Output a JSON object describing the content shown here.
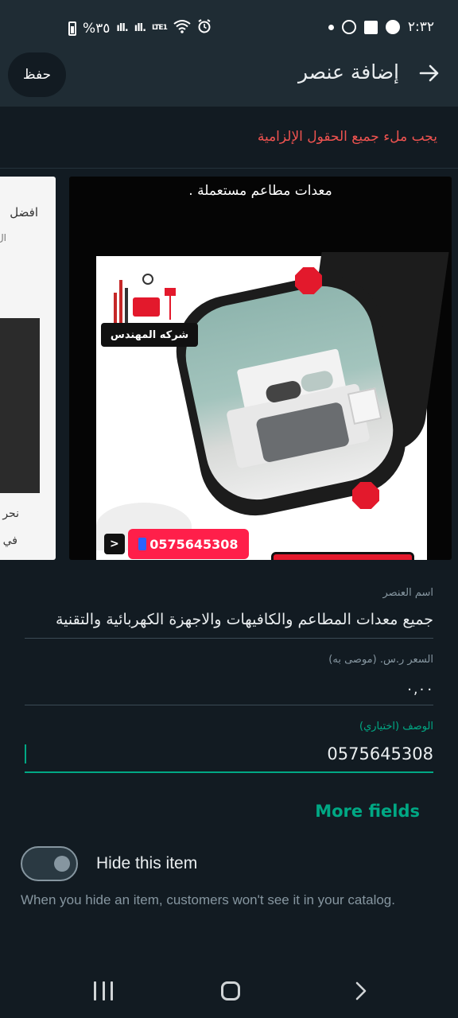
{
  "status_bar": {
    "time": "٢:٣٢",
    "battery": "%٣٥",
    "network_label": "LTE1",
    "icons": [
      "whatsapp-icon",
      "facebook-icon",
      "shazam-icon",
      "alarm-icon",
      "wifi-icon",
      "signal-icon",
      "battery-icon"
    ]
  },
  "appbar": {
    "title": "إضافة عنصر",
    "save_label": "حفظ"
  },
  "error": {
    "message": "يجب ملء جميع الحقول الإلزامية",
    "color": "#ef5350"
  },
  "images": {
    "previous_thumb": {
      "line1": "افضل",
      "line2": "ال",
      "line3": "نحر",
      "line4": "في"
    },
    "main_thumb": {
      "headline": "معدات مطاعم مستعملة .",
      "company_tag": "شركه المهندس",
      "phone": "0575645308"
    }
  },
  "form": {
    "name": {
      "label": "اسم العنصر",
      "value": "جميع معدات المطاعم والكافيهات والاجهزة الكهربائية والتقنية"
    },
    "price": {
      "label": "السعر ر.س. (موصى به)",
      "value": "٠,٠٠"
    },
    "description": {
      "label": "الوصف (اختياري)",
      "value": "0575645308"
    }
  },
  "more_fields_label": "More fields",
  "hide_item": {
    "label": "Hide this item",
    "helper": "When you hide an item, customers won't see it in your catalog.",
    "enabled": false
  },
  "colors": {
    "accent": "#00a884",
    "background": "#121b22",
    "bar": "#1f2c34"
  }
}
